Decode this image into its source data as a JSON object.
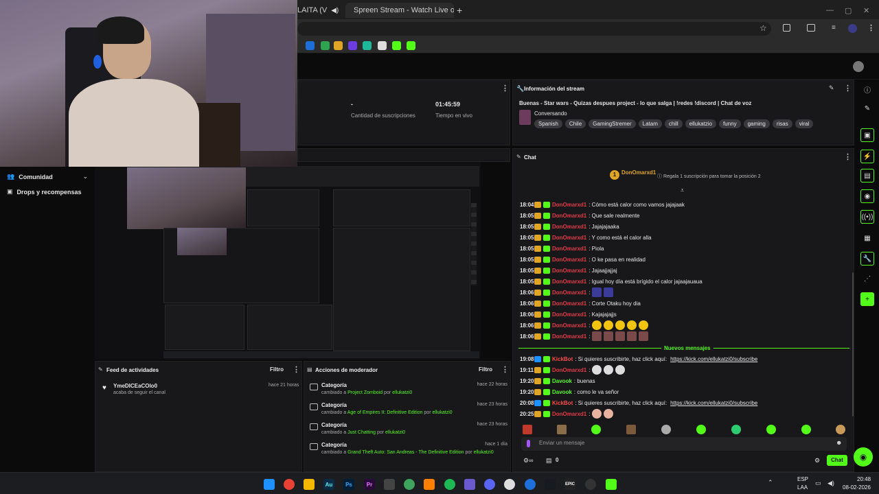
{
  "browser": {
    "tabs": [
      {
        "title": "LAITA (V",
        "muted": true
      },
      {
        "title": "Spreen Stream - Watch Live on"
      }
    ],
    "new_tab_symbol": "+"
  },
  "left_nav": {
    "items": [
      {
        "label": "Comunidad",
        "icon": "people-icon",
        "expanded": true
      },
      {
        "label": "Drops y recompensas",
        "icon": "gift-icon"
      }
    ]
  },
  "stats": {
    "subs_value": "-",
    "subs_label": "Cantidad de suscripciones",
    "live_value": "01:45:59",
    "live_label": "Tiempo en vivo"
  },
  "stream_info": {
    "title": "Información del stream",
    "stream_title": "Buenas - Star wars - Quizas despues project - lo que salga | !redes !discord | Chat de voz",
    "category": "Conversando",
    "tags": [
      "Spanish",
      "Chile",
      "GamingStremer",
      "Latam",
      "chill",
      "ellukatzio",
      "funny",
      "gaming",
      "risas",
      "viral"
    ]
  },
  "chat": {
    "title": "Chat",
    "pinned_user": "DonOmarxd1",
    "pinned_rank": "1",
    "pinned_hint": "Regala 1 suscripción para tomar la posición 2",
    "messages": [
      {
        "time": "18:04",
        "user": "DonOmarxd1",
        "text": ": Cómo está calor como vamos jajajaak"
      },
      {
        "time": "18:05",
        "user": "DonOmarxd1",
        "text": ": Que sale realmente"
      },
      {
        "time": "18:05",
        "user": "DonOmarxd1",
        "text": ": Jajajajaaka"
      },
      {
        "time": "18:05",
        "user": "DonOmarxd1",
        "text": ": Y como está el calor alla"
      },
      {
        "time": "18:05",
        "user": "DonOmarxd1",
        "text": ": Piola"
      },
      {
        "time": "18:05",
        "user": "DonOmarxd1",
        "text": ": O ke pasa en realidad"
      },
      {
        "time": "18:05",
        "user": "DonOmarxd1",
        "text": ": Jajaajjajjaj"
      },
      {
        "time": "18:05",
        "user": "DonOmarxd1",
        "text": ": Igual hoy día está brígido el calor jajaajauaua"
      },
      {
        "time": "18:06",
        "user": "DonOmarxd1",
        "text": ":"
      },
      {
        "time": "18:06",
        "user": "DonOmarxd1",
        "text": ": Corte Otaku hoy dia"
      },
      {
        "time": "18:06",
        "user": "DonOmarxd1",
        "text": ": Kajajajajjs"
      },
      {
        "time": "18:06",
        "user": "DonOmarxd1",
        "text": ":"
      },
      {
        "time": "18:06",
        "user": "DonOmarxd1",
        "text": ":"
      }
    ],
    "new_messages_label": "Nuevos mensajes",
    "new_messages": [
      {
        "time": "19:08",
        "user": "KickBot",
        "color": "#ff4a4a",
        "text": ": Si quieres suscribirte, haz click aquí:",
        "link": "https://kick.com/ellukatzi0/subscribe"
      },
      {
        "time": "19:11",
        "user": "DonOmarxd1",
        "color": "#e63946",
        "text": ":"
      },
      {
        "time": "19:20",
        "user": "Davook",
        "color": "#53fc18",
        "text": ": buenas"
      },
      {
        "time": "19:20",
        "user": "Davook",
        "color": "#53fc18",
        "text": ": como le va señor"
      },
      {
        "time": "20:08",
        "user": "KickBot",
        "color": "#ff4a4a",
        "text": ": Si quieres suscribirte, haz click aquí:",
        "link": "https://kick.com/ellukatzi0/subscribe"
      },
      {
        "time": "20:25",
        "user": "DonOmarxd1",
        "color": "#e63946",
        "text": ":"
      }
    ],
    "input_placeholder": "Enviar un mensaje",
    "points": "0",
    "send_label": "Chat"
  },
  "activity_feed": {
    "title": "Feed de actividades",
    "filter_label": "Filtro",
    "items": [
      {
        "user": "YmeDICEaCOlo0",
        "action": "acaba de seguir el canal",
        "time": "hace 21 horas"
      }
    ]
  },
  "mod_actions": {
    "title": "Acciones de moderador",
    "filter_label": "Filtro",
    "items": [
      {
        "heading": "Categoría",
        "prefix": "cambiado a",
        "target": "Project Zomboid",
        "by": "por",
        "user": "ellukatzi0",
        "time": "hace 22 horas"
      },
      {
        "heading": "Categoría",
        "prefix": "cambiado a",
        "target": "Age of Empires II: Definitive Edition",
        "by": "por",
        "user": "ellukatzi0",
        "time": "hace 23 horas"
      },
      {
        "heading": "Categoría",
        "prefix": "cambiado a",
        "target": "Just Chatting",
        "by": "por",
        "user": "ellukatzi0",
        "time": "hace 23 horas"
      },
      {
        "heading": "Categoría",
        "prefix": "cambiado a",
        "target": "Grand Theft Auto: San Andreas - The Definitive Edition",
        "by": "por",
        "user": "ellukatzi0",
        "time": "hace 1 día"
      }
    ]
  },
  "taskbar": {
    "lang": "ESP",
    "lang2": "LAA",
    "time": "20:48",
    "date": "08-02-2026",
    "apps": [
      "Au",
      "Ps",
      "Pr",
      "EPIC"
    ]
  },
  "colors": {
    "kick_green": "#53fc18",
    "panel": "#18181a",
    "bg": "#0b0b0c"
  }
}
